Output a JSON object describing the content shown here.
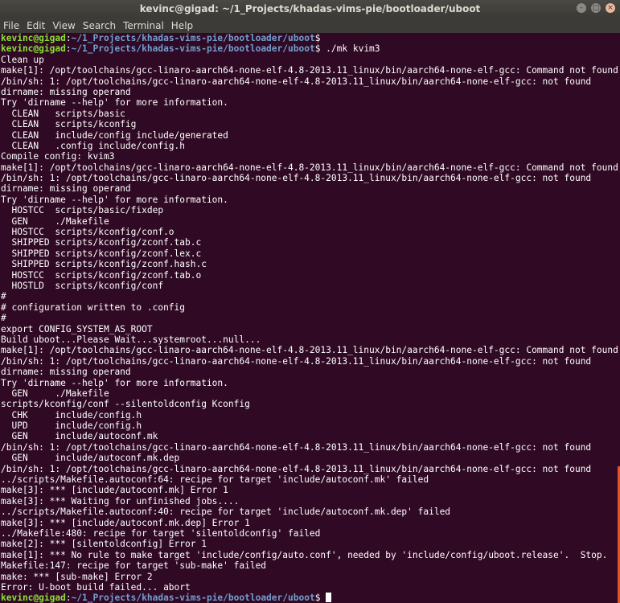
{
  "window": {
    "title": "kevinc@gigad: ~/1_Projects/khadas-vims-pie/bootloader/uboot"
  },
  "menu": [
    "File",
    "Edit",
    "View",
    "Search",
    "Terminal",
    "Help"
  ],
  "prompt": {
    "userhost": "kevinc@gigad",
    "path": "~/1_Projects/khadas-vims-pie/bootloader/uboot"
  },
  "colors": {
    "background": "#300a24",
    "prompt_user": "#8ae234",
    "prompt_path": "#729fcf"
  },
  "lines": [
    {
      "type": "prompt",
      "cmd": ""
    },
    {
      "type": "prompt",
      "cmd": " ./mk kvim3"
    },
    {
      "type": "out",
      "text": "Clean up"
    },
    {
      "type": "out",
      "text": "make[1]: /opt/toolchains/gcc-linaro-aarch64-none-elf-4.8-2013.11_linux/bin/aarch64-none-elf-gcc: Command not found"
    },
    {
      "type": "out",
      "text": "/bin/sh: 1: /opt/toolchains/gcc-linaro-aarch64-none-elf-4.8-2013.11_linux/bin/aarch64-none-elf-gcc: not found"
    },
    {
      "type": "out",
      "text": "dirname: missing operand"
    },
    {
      "type": "out",
      "text": "Try 'dirname --help' for more information."
    },
    {
      "type": "out",
      "text": "  CLEAN   scripts/basic"
    },
    {
      "type": "out",
      "text": "  CLEAN   scripts/kconfig"
    },
    {
      "type": "out",
      "text": "  CLEAN   include/config include/generated"
    },
    {
      "type": "out",
      "text": "  CLEAN   .config include/config.h"
    },
    {
      "type": "out",
      "text": "Compile config: kvim3"
    },
    {
      "type": "out",
      "text": "make[1]: /opt/toolchains/gcc-linaro-aarch64-none-elf-4.8-2013.11_linux/bin/aarch64-none-elf-gcc: Command not found"
    },
    {
      "type": "out",
      "text": "/bin/sh: 1: /opt/toolchains/gcc-linaro-aarch64-none-elf-4.8-2013.11_linux/bin/aarch64-none-elf-gcc: not found"
    },
    {
      "type": "out",
      "text": "dirname: missing operand"
    },
    {
      "type": "out",
      "text": "Try 'dirname --help' for more information."
    },
    {
      "type": "out",
      "text": "  HOSTCC  scripts/basic/fixdep"
    },
    {
      "type": "out",
      "text": "  GEN     ./Makefile"
    },
    {
      "type": "out",
      "text": "  HOSTCC  scripts/kconfig/conf.o"
    },
    {
      "type": "out",
      "text": "  SHIPPED scripts/kconfig/zconf.tab.c"
    },
    {
      "type": "out",
      "text": "  SHIPPED scripts/kconfig/zconf.lex.c"
    },
    {
      "type": "out",
      "text": "  SHIPPED scripts/kconfig/zconf.hash.c"
    },
    {
      "type": "out",
      "text": "  HOSTCC  scripts/kconfig/zconf.tab.o"
    },
    {
      "type": "out",
      "text": "  HOSTLD  scripts/kconfig/conf"
    },
    {
      "type": "out",
      "text": "#"
    },
    {
      "type": "out",
      "text": "# configuration written to .config"
    },
    {
      "type": "out",
      "text": "#"
    },
    {
      "type": "out",
      "text": "export CONFIG_SYSTEM_AS_ROOT"
    },
    {
      "type": "out",
      "text": "Build uboot...Please Wait...systemroot...null..."
    },
    {
      "type": "out",
      "text": "make[1]: /opt/toolchains/gcc-linaro-aarch64-none-elf-4.8-2013.11_linux/bin/aarch64-none-elf-gcc: Command not found"
    },
    {
      "type": "out",
      "text": "/bin/sh: 1: /opt/toolchains/gcc-linaro-aarch64-none-elf-4.8-2013.11_linux/bin/aarch64-none-elf-gcc: not found"
    },
    {
      "type": "out",
      "text": "dirname: missing operand"
    },
    {
      "type": "out",
      "text": "Try 'dirname --help' for more information."
    },
    {
      "type": "out",
      "text": "  GEN     ./Makefile"
    },
    {
      "type": "out",
      "text": "scripts/kconfig/conf --silentoldconfig Kconfig"
    },
    {
      "type": "out",
      "text": "  CHK     include/config.h"
    },
    {
      "type": "out",
      "text": "  UPD     include/config.h"
    },
    {
      "type": "out",
      "text": "  GEN     include/autoconf.mk"
    },
    {
      "type": "out",
      "text": "/bin/sh: 1: /opt/toolchains/gcc-linaro-aarch64-none-elf-4.8-2013.11_linux/bin/aarch64-none-elf-gcc: not found"
    },
    {
      "type": "out",
      "text": "  GEN     include/autoconf.mk.dep"
    },
    {
      "type": "out",
      "text": "/bin/sh: 1: /opt/toolchains/gcc-linaro-aarch64-none-elf-4.8-2013.11_linux/bin/aarch64-none-elf-gcc: not found"
    },
    {
      "type": "out",
      "text": "../scripts/Makefile.autoconf:64: recipe for target 'include/autoconf.mk' failed"
    },
    {
      "type": "out",
      "text": "make[3]: *** [include/autoconf.mk] Error 1"
    },
    {
      "type": "out",
      "text": "make[3]: *** Waiting for unfinished jobs...."
    },
    {
      "type": "out",
      "text": "../scripts/Makefile.autoconf:40: recipe for target 'include/autoconf.mk.dep' failed"
    },
    {
      "type": "out",
      "text": "make[3]: *** [include/autoconf.mk.dep] Error 1"
    },
    {
      "type": "out",
      "text": "../Makefile:480: recipe for target 'silentoldconfig' failed"
    },
    {
      "type": "out",
      "text": "make[2]: *** [silentoldconfig] Error 1"
    },
    {
      "type": "out",
      "text": "make[1]: *** No rule to make target 'include/config/auto.conf', needed by 'include/config/uboot.release'.  Stop."
    },
    {
      "type": "out",
      "text": "Makefile:147: recipe for target 'sub-make' failed"
    },
    {
      "type": "out",
      "text": "make: *** [sub-make] Error 2"
    },
    {
      "type": "out",
      "text": "Error: U-boot build failed... abort"
    },
    {
      "type": "prompt",
      "cmd": " ",
      "cursor": true
    }
  ]
}
